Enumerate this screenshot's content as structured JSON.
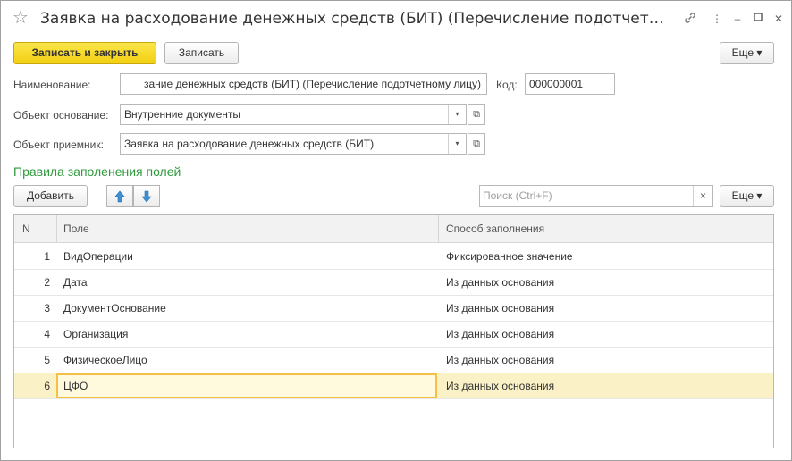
{
  "window": {
    "title": "Заявка на расходование денежных средств (БИТ) (Перечисление подотчетн...",
    "link_icon": "🔗",
    "more_icon": "⋮",
    "minimize_icon": "–",
    "maximize_icon": "☐",
    "close_icon": "✕"
  },
  "toolbar": {
    "save_close_label": "Записать и закрыть",
    "save_label": "Записать",
    "more_label": "Еще ▾"
  },
  "form": {
    "name_label": "Наименование:",
    "name_value": "зание денежных средств (БИТ) (Перечисление подотчетному лицу)",
    "code_label": "Код:",
    "code_value": "000000001",
    "base_object_label": "Объект основание:",
    "base_object_value": "Внутренние документы",
    "target_object_label": "Объект приемник:",
    "target_object_value": "Заявка на расходование денежных средств (БИТ)",
    "dropdown_glyph": "▾",
    "open_glyph": "⧉"
  },
  "rules": {
    "title": "Правила заполенения полей",
    "add_label": "Добавить",
    "up_glyph": "🡅",
    "down_glyph": "🡇",
    "search_placeholder": "Поиск (Ctrl+F)",
    "clear_glyph": "×",
    "more_label": "Еще ▾",
    "columns": {
      "n": "N",
      "field": "Поле",
      "method": "Способ заполнения"
    },
    "rows": [
      {
        "n": "1",
        "field": "ВидОперации",
        "method": "Фиксированное значение"
      },
      {
        "n": "2",
        "field": "Дата",
        "method": "Из данных основания"
      },
      {
        "n": "3",
        "field": "ДокументОснование",
        "method": "Из данных основания"
      },
      {
        "n": "4",
        "field": "Организация",
        "method": "Из данных основания"
      },
      {
        "n": "5",
        "field": "ФизическоеЛицо",
        "method": "Из данных основания"
      },
      {
        "n": "6",
        "field": "ЦФО",
        "method": "Из данных основания"
      }
    ],
    "selected_row": 6
  },
  "colors": {
    "primary_button": "#f5d31c",
    "section_title": "#2e9b3c",
    "selected_row": "#fbf1c6",
    "focus_border": "#f4c046"
  }
}
